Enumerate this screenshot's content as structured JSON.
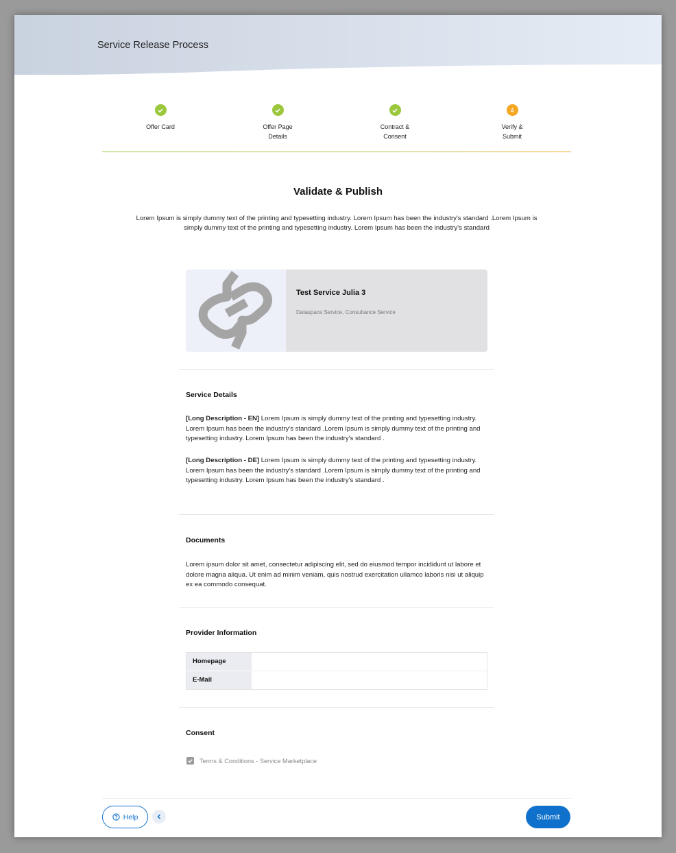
{
  "header": {
    "title": "Service Release Process"
  },
  "steps": [
    {
      "label_line1": "Offer Card",
      "label_line2": "",
      "status": "done"
    },
    {
      "label_line1": "Offer Page",
      "label_line2": "Details",
      "status": "done"
    },
    {
      "label_line1": "Contract &",
      "label_line2": "Consent",
      "status": "done"
    },
    {
      "label_line1": "Verify &",
      "label_line2": "Submit",
      "status": "current",
      "number": "4"
    }
  ],
  "colors": {
    "done": "#9ac73b",
    "current": "#f5a623",
    "primary": "#0f71cb"
  },
  "page": {
    "title": "Validate & Publish",
    "intro_line1": "Lorem Ipsum is simply dummy text of the printing and typesetting industry. Lorem Ipsum has been the industry's standard .Lorem Ipsum is",
    "intro_line2": "simply dummy text of the printing and typesetting industry. Lorem Ipsum has been the industry's standard"
  },
  "service_card": {
    "name": "Test Service Julia 3",
    "tags": "Dataspace Service, Consultance Service",
    "logo_icon": "chain-link-logo-icon"
  },
  "service_details": {
    "title": "Service Details",
    "desc_en_label": "[Long Description - EN]",
    "desc_en_text": " Lorem Ipsum is simply dummy text of the printing and typesetting industry. Lorem Ipsum has been the industry's standard .Lorem Ipsum is simply dummy text of the printing and typesetting industry. Lorem Ipsum has been the industry's standard .",
    "desc_de_label": "[Long Description - DE]",
    "desc_de_text": " Lorem Ipsum is simply dummy text of the printing and typesetting industry. Lorem Ipsum has been the industry's standard .Lorem Ipsum is simply dummy text of the printing and typesetting industry. Lorem Ipsum has been the industry's standard ."
  },
  "documents": {
    "title": "Documents",
    "text": "Lorem ipsum dolor sit amet, consectetur adipiscing elit, sed do eiusmod tempor incididunt ut labore et dolore magna aliqua. Ut enim ad minim veniam, quis nostrud exercitation ullamco laboris nisi ut aliquip ex ea commodo consequat."
  },
  "provider": {
    "title": "Provider Information",
    "rows": [
      {
        "key": "Homepage",
        "value": ""
      },
      {
        "key": "E-Mail",
        "value": ""
      }
    ]
  },
  "consent": {
    "title": "Consent",
    "checkbox_label": "Terms & Conditions - Service Marketplace",
    "checked": true
  },
  "footer": {
    "help_label": "Help",
    "submit_label": "Submit"
  }
}
